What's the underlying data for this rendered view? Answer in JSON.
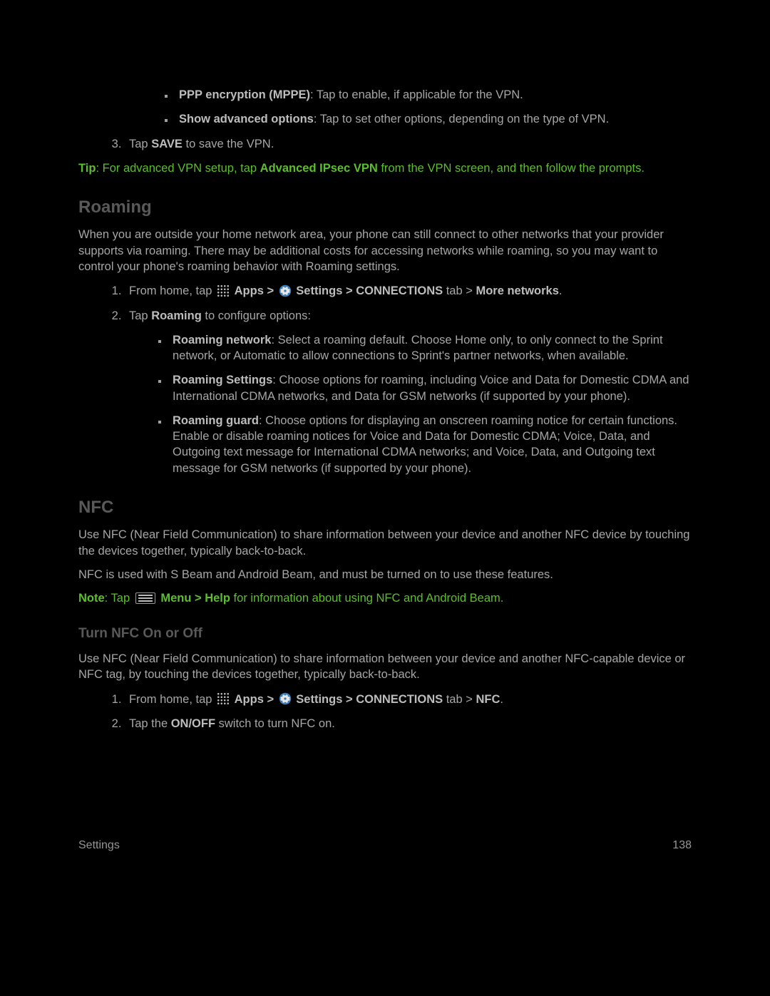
{
  "vpn": {
    "bullet_ppp_bold": "PPP encryption (MPPE)",
    "bullet_ppp_rest": ": Tap to enable, if applicable for the VPN.",
    "bullet_adv_bold": "Show advanced options",
    "bullet_adv_rest": ": Tap to set other options, depending on the type of VPN.",
    "step3_pre": "Tap ",
    "step3_save": "SAVE",
    "step3_post": " to save the VPN.",
    "tip_label": "Tip",
    "tip_pre": ": For advanced VPN setup, tap ",
    "tip_bold": "Advanced IPsec VPN",
    "tip_post": " from the VPN screen, and then follow the prompts."
  },
  "roaming": {
    "heading": "Roaming",
    "intro": "When you are outside your home network area, your phone can still connect to other networks that your provider supports via roaming. There may be additional costs for accessing networks while roaming, so you may want to control your phone's roaming behavior with Roaming settings.",
    "step1_pre": "From home, tap ",
    "apps_label": "Apps > ",
    "settings_label": "Settings > CONNECTIONS ",
    "step1_mid": "tab > ",
    "step1_end": "More networks",
    "step2_pre": "Tap ",
    "step2_bold": "Roaming",
    "step2_post": " to configure options:",
    "opt_rn_bold": "Roaming network",
    "opt_rn_rest": ": Select a roaming default. Choose Home only, to only connect to the Sprint network, or Automatic to allow connections to Sprint's partner networks, when available.",
    "opt_rs_bold": "Roaming Settings",
    "opt_rs_rest": ": Choose options for roaming, including Voice and Data for Domestic CDMA and International CDMA networks, and Data for GSM networks (if supported by your phone).",
    "opt_rg_bold": "Roaming guard",
    "opt_rg_rest": ": Choose options for displaying an onscreen roaming notice for certain functions. Enable or disable roaming notices for Voice and Data for Domestic CDMA; Voice, Data, and Outgoing text message for International CDMA networks; and Voice, Data, and Outgoing text message for GSM networks (if supported by your phone)."
  },
  "nfc": {
    "heading": "NFC",
    "intro1": "Use NFC (Near Field Communication) to share information between your device and another NFC device by touching the devices together, typically back-to-back.",
    "intro2": "NFC is used with S Beam and Android Beam, and must be turned on to use these features.",
    "note_label": "Note",
    "note_pre": ": Tap ",
    "note_bold1": "Menu > Help",
    "note_post": " for information about using NFC and Android Beam.",
    "sub_heading": "Turn NFC On or Off",
    "sub_intro": "Use NFC (Near Field Communication) to share information between your device and another NFC-capable device or NFC tag, by touching the devices together, typically back-to-back.",
    "step1_end": "NFC",
    "step2_pre": "Tap the ",
    "step2_bold": "ON/OFF",
    "step2_post": " switch to turn NFC on."
  },
  "footer": {
    "left": "Settings",
    "right": "138"
  }
}
